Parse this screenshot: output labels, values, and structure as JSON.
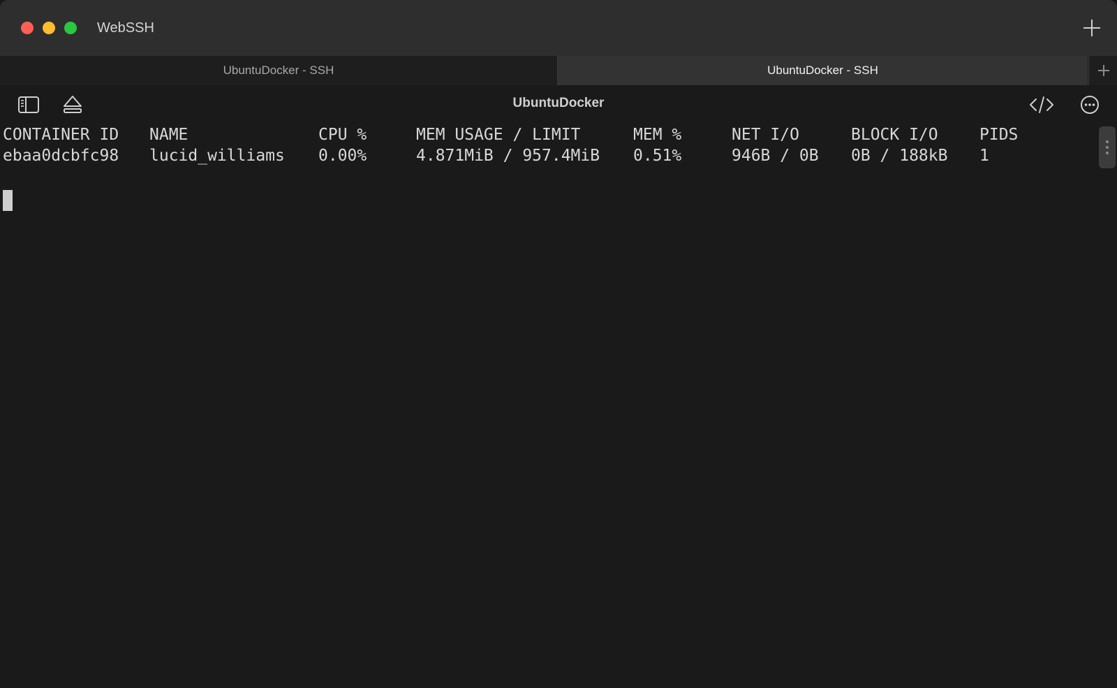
{
  "window": {
    "app_title": "WebSSH"
  },
  "tabs": [
    {
      "label": "UbuntuDocker - SSH",
      "active": false
    },
    {
      "label": "UbuntuDocker - SSH",
      "active": true
    }
  ],
  "toolbar": {
    "session_title": "UbuntuDocker",
    "icons": [
      "sidebar-icon",
      "eject-icon",
      "code-icon",
      "more-icon"
    ]
  },
  "terminal": {
    "headers": [
      "CONTAINER ID",
      "NAME",
      "CPU %",
      "MEM USAGE / LIMIT",
      "MEM %",
      "NET I/O",
      "BLOCK I/O",
      "PIDS"
    ],
    "rows": [
      [
        "ebaa0dcbfc98",
        "lucid_williams",
        "0.00%",
        "4.871MiB / 957.4MiB",
        "0.51%",
        "946B / 0B",
        "0B / 188kB",
        "1"
      ]
    ]
  },
  "colors": {
    "close": "#fe5f57",
    "minimize": "#febc2e",
    "zoom": "#28c840",
    "background": "#1a1a1a"
  }
}
